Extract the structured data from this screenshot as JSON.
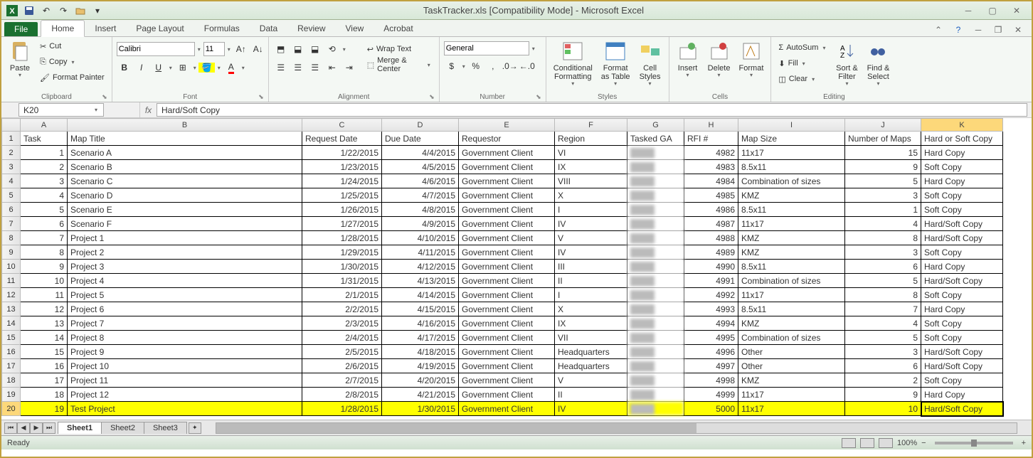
{
  "window": {
    "title": "TaskTracker.xls  [Compatibility Mode] - Microsoft Excel"
  },
  "tabs": {
    "file": "File",
    "list": [
      "Home",
      "Insert",
      "Page Layout",
      "Formulas",
      "Data",
      "Review",
      "View",
      "Acrobat"
    ],
    "active": "Home"
  },
  "ribbon": {
    "clipboard": {
      "label": "Clipboard",
      "paste": "Paste",
      "cut": "Cut",
      "copy": "Copy",
      "painter": "Format Painter"
    },
    "font": {
      "label": "Font",
      "name": "Calibri",
      "size": "11"
    },
    "alignment": {
      "label": "Alignment",
      "wrap": "Wrap Text",
      "merge": "Merge & Center"
    },
    "number": {
      "label": "Number",
      "format": "General"
    },
    "styles": {
      "label": "Styles",
      "cond": "Conditional\nFormatting",
      "table": "Format\nas Table",
      "cell": "Cell\nStyles"
    },
    "cells": {
      "label": "Cells",
      "insert": "Insert",
      "delete": "Delete",
      "format": "Format"
    },
    "editing": {
      "label": "Editing",
      "autosum": "AutoSum",
      "fill": "Fill",
      "clear": "Clear",
      "sort": "Sort &\nFilter",
      "find": "Find &\nSelect"
    }
  },
  "namebox": "K20",
  "formula": "Hard/Soft Copy",
  "columns": [
    "A",
    "B",
    "C",
    "D",
    "E",
    "F",
    "G",
    "H",
    "I",
    "J",
    "K"
  ],
  "headers": {
    "A": "Task",
    "B": "Map Title",
    "C": "Request Date",
    "D": "Due Date",
    "E": "Requestor",
    "F": "Region",
    "G": "Tasked GA",
    "H": "RFI #",
    "I": "Map Size",
    "J": "Number of Maps",
    "K": "Hard or Soft Copy"
  },
  "rows": [
    {
      "n": 2,
      "A": "1",
      "B": "Scenario A",
      "C": "1/22/2015",
      "D": "4/4/2015",
      "E": "Government Client",
      "F": "VI",
      "G": "",
      "H": "4982",
      "I": "11x17",
      "J": "15",
      "K": "Hard Copy"
    },
    {
      "n": 3,
      "A": "2",
      "B": "Scenario B",
      "C": "1/23/2015",
      "D": "4/5/2015",
      "E": "Government Client",
      "F": "IX",
      "G": "",
      "H": "4983",
      "I": "8.5x11",
      "J": "9",
      "K": "Soft Copy"
    },
    {
      "n": 4,
      "A": "3",
      "B": "Scenario C",
      "C": "1/24/2015",
      "D": "4/6/2015",
      "E": "Government Client",
      "F": "VIII",
      "G": "",
      "H": "4984",
      "I": "Combination of sizes",
      "J": "5",
      "K": "Hard Copy"
    },
    {
      "n": 5,
      "A": "4",
      "B": "Scenario D",
      "C": "1/25/2015",
      "D": "4/7/2015",
      "E": "Government Client",
      "F": "X",
      "G": "",
      "H": "4985",
      "I": "KMZ",
      "J": "3",
      "K": "Soft Copy"
    },
    {
      "n": 6,
      "A": "5",
      "B": "Scenario E",
      "C": "1/26/2015",
      "D": "4/8/2015",
      "E": "Government Client",
      "F": "I",
      "G": "",
      "H": "4986",
      "I": "8.5x11",
      "J": "1",
      "K": "Soft Copy"
    },
    {
      "n": 7,
      "A": "6",
      "B": "Scenario F",
      "C": "1/27/2015",
      "D": "4/9/2015",
      "E": "Government Client",
      "F": "IV",
      "G": "",
      "H": "4987",
      "I": "11x17",
      "J": "4",
      "K": "Hard/Soft Copy"
    },
    {
      "n": 8,
      "A": "7",
      "B": "Project 1",
      "C": "1/28/2015",
      "D": "4/10/2015",
      "E": "Government Client",
      "F": "V",
      "G": "",
      "H": "4988",
      "I": "KMZ",
      "J": "8",
      "K": "Hard/Soft Copy"
    },
    {
      "n": 9,
      "A": "8",
      "B": "Project 2",
      "C": "1/29/2015",
      "D": "4/11/2015",
      "E": "Government Client",
      "F": "IV",
      "G": "",
      "H": "4989",
      "I": "KMZ",
      "J": "3",
      "K": "Soft Copy"
    },
    {
      "n": 10,
      "A": "9",
      "B": "Project 3",
      "C": "1/30/2015",
      "D": "4/12/2015",
      "E": "Government Client",
      "F": "III",
      "G": "",
      "H": "4990",
      "I": "8.5x11",
      "J": "6",
      "K": "Hard Copy"
    },
    {
      "n": 11,
      "A": "10",
      "B": "Project 4",
      "C": "1/31/2015",
      "D": "4/13/2015",
      "E": "Government Client",
      "F": "II",
      "G": "",
      "H": "4991",
      "I": "Combination of sizes",
      "J": "5",
      "K": "Hard/Soft Copy"
    },
    {
      "n": 12,
      "A": "11",
      "B": "Project 5",
      "C": "2/1/2015",
      "D": "4/14/2015",
      "E": "Government Client",
      "F": "I",
      "G": "",
      "H": "4992",
      "I": "11x17",
      "J": "8",
      "K": "Soft Copy"
    },
    {
      "n": 13,
      "A": "12",
      "B": "Project 6",
      "C": "2/2/2015",
      "D": "4/15/2015",
      "E": "Government Client",
      "F": "X",
      "G": "",
      "H": "4993",
      "I": "8.5x11",
      "J": "7",
      "K": "Hard Copy"
    },
    {
      "n": 14,
      "A": "13",
      "B": "Project 7",
      "C": "2/3/2015",
      "D": "4/16/2015",
      "E": "Government Client",
      "F": "IX",
      "G": "",
      "H": "4994",
      "I": "KMZ",
      "J": "4",
      "K": "Soft Copy"
    },
    {
      "n": 15,
      "A": "14",
      "B": "Project 8",
      "C": "2/4/2015",
      "D": "4/17/2015",
      "E": "Government Client",
      "F": "VII",
      "G": "",
      "H": "4995",
      "I": "Combination of sizes",
      "J": "5",
      "K": "Soft Copy"
    },
    {
      "n": 16,
      "A": "15",
      "B": "Project 9",
      "C": "2/5/2015",
      "D": "4/18/2015",
      "E": "Government Client",
      "F": "Headquarters",
      "G": "",
      "H": "4996",
      "I": "Other",
      "J": "3",
      "K": "Hard/Soft Copy"
    },
    {
      "n": 17,
      "A": "16",
      "B": "Project 10",
      "C": "2/6/2015",
      "D": "4/19/2015",
      "E": "Government Client",
      "F": "Headquarters",
      "G": "",
      "H": "4997",
      "I": "Other",
      "J": "6",
      "K": "Hard/Soft Copy"
    },
    {
      "n": 18,
      "A": "17",
      "B": "Project 11",
      "C": "2/7/2015",
      "D": "4/20/2015",
      "E": "Government Client",
      "F": "V",
      "G": "",
      "H": "4998",
      "I": "KMZ",
      "J": "2",
      "K": "Soft Copy"
    },
    {
      "n": 19,
      "A": "18",
      "B": "Project 12",
      "C": "2/8/2015",
      "D": "4/21/2015",
      "E": "Government Client",
      "F": "II",
      "G": "",
      "H": "4999",
      "I": "11x17",
      "J": "9",
      "K": "Hard Copy"
    },
    {
      "n": 20,
      "A": "19",
      "B": "Test Project",
      "C": "1/28/2015",
      "D": "1/30/2015",
      "E": "Government Client",
      "F": "IV",
      "G": "",
      "H": "5000",
      "I": "11x17",
      "J": "10",
      "K": "Hard/Soft Copy",
      "hl": true
    }
  ],
  "activeCell": {
    "row": 20,
    "col": "K"
  },
  "sheets": [
    "Sheet1",
    "Sheet2",
    "Sheet3"
  ],
  "activeSheet": "Sheet1",
  "status": "Ready",
  "zoom": "100%"
}
